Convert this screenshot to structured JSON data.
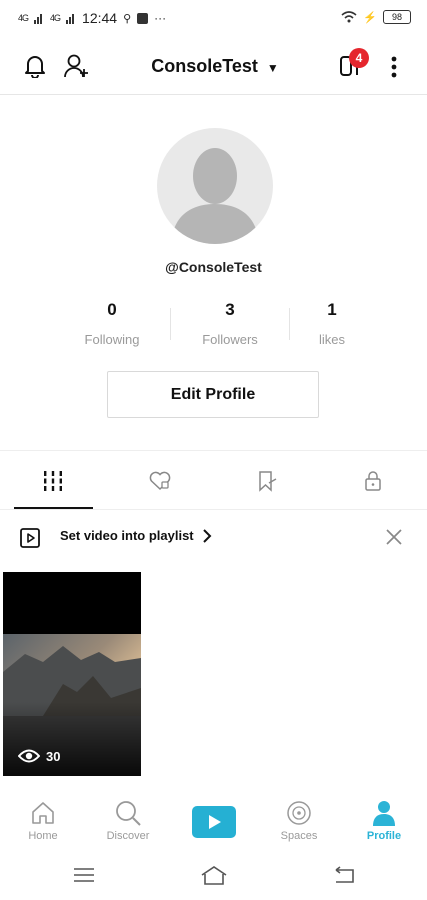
{
  "status_bar": {
    "signal1": "4G",
    "signal2": "4G",
    "time": "12:44",
    "battery": "98"
  },
  "header": {
    "title": "ConsoleTest",
    "notification_count": "4"
  },
  "profile": {
    "username": "@ConsoleTest",
    "stats": [
      {
        "value": "0",
        "label": "Following"
      },
      {
        "value": "3",
        "label": "Followers"
      },
      {
        "value": "1",
        "label": "likes"
      }
    ],
    "edit_label": "Edit Profile"
  },
  "tabs": [
    "videos-grid",
    "liked",
    "favorites",
    "private"
  ],
  "playlist_banner": {
    "text": "Set video into playlist"
  },
  "videos": [
    {
      "views": "30"
    }
  ],
  "bottom_nav": {
    "items": [
      {
        "label": "Home",
        "icon": "home-icon"
      },
      {
        "label": "Discover",
        "icon": "search-icon"
      },
      {
        "label": "",
        "icon": "play-icon"
      },
      {
        "label": "Spaces",
        "icon": "spaces-icon"
      },
      {
        "label": "Profile",
        "icon": "profile-icon"
      }
    ],
    "active": "Profile"
  },
  "colors": {
    "accent": "#25b0d3",
    "badge": "#e5262d"
  }
}
